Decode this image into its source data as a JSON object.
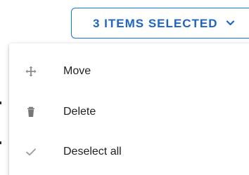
{
  "selection_button": {
    "label": "3 ITEMS SELECTED",
    "icon": "chevron-down-icon",
    "accent": "#1a73e8"
  },
  "menu": {
    "items": [
      {
        "label": "Move",
        "icon": "move-icon"
      },
      {
        "label": "Delete",
        "icon": "trash-icon"
      },
      {
        "label": "Deselect all",
        "icon": "check-icon"
      }
    ]
  }
}
